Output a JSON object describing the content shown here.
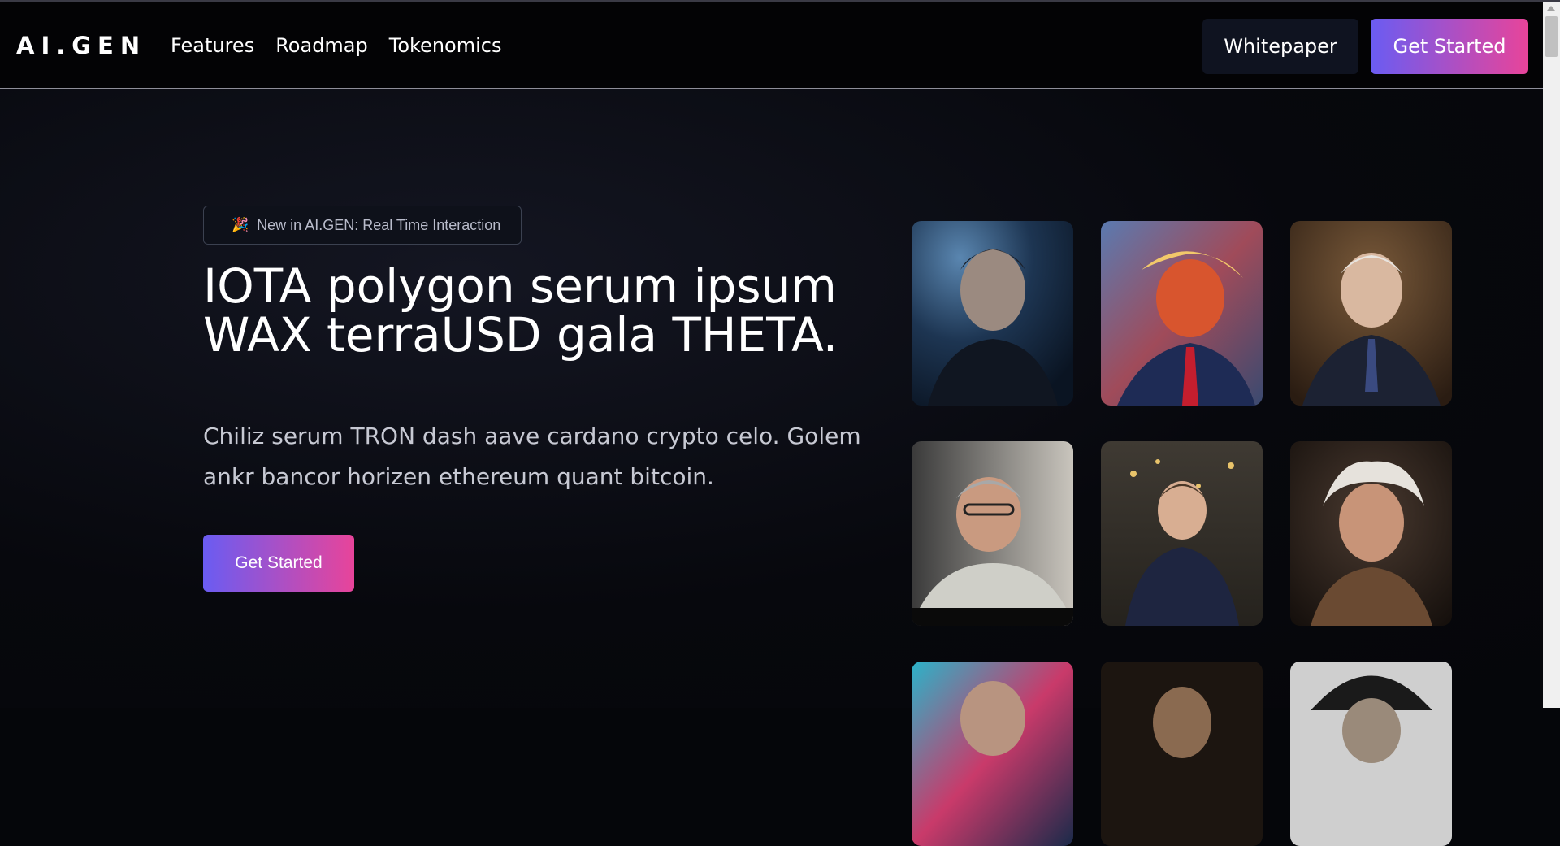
{
  "nav": {
    "brand": "AI.GEN",
    "links": [
      "Features",
      "Roadmap",
      "Tokenomics"
    ],
    "whitepaper_label": "Whitepaper",
    "get_started_label": "Get Started"
  },
  "hero": {
    "badge_icon": "party-popper-icon",
    "badge_text": "New in AI.GEN: Real Time Interaction",
    "headline_line1": "IOTA polygon serum ipsum",
    "headline_line2": "WAX terraUSD gala THETA.",
    "subtext_line1": "Chiliz serum TRON dash aave cardano crypto celo. Golem",
    "subtext_line2": "ankr bancor horizen ethereum quant bitcoin.",
    "cta_label": "Get Started"
  },
  "colors": {
    "background": "#05060a",
    "gradient_start": "#6a5cf2",
    "gradient_end": "#e8449a",
    "secondary_button": "#0f1320"
  },
  "gallery": {
    "portraits": [
      {
        "name": "portrait-man-dark-hair-blue-light"
      },
      {
        "name": "portrait-man-blonde-hair-red-tie"
      },
      {
        "name": "portrait-man-white-hair-suit"
      },
      {
        "name": "portrait-man-glasses-window"
      },
      {
        "name": "portrait-man-navy-tshirt-cafe"
      },
      {
        "name": "portrait-elderly-man-wild-hair"
      },
      {
        "name": "portrait-man-glasses-neon"
      },
      {
        "name": "portrait-man-dark-bg"
      },
      {
        "name": "portrait-man-black-hat"
      }
    ]
  }
}
